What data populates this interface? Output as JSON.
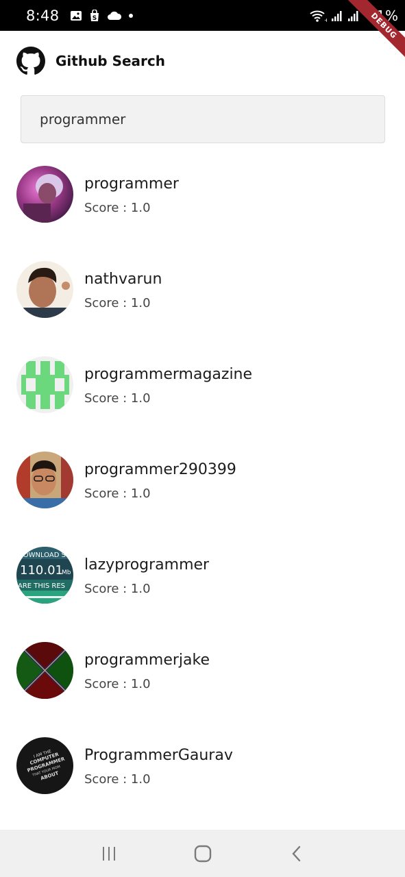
{
  "status_bar": {
    "time": "8:48",
    "battery": "31%",
    "icons": [
      "gallery-icon",
      "shop-icon",
      "cloud-icon",
      "dot-icon",
      "wifi-icon",
      "signal-icon",
      "signal-icon"
    ]
  },
  "debug_banner": "DEBUG",
  "app_bar": {
    "title": "Github Search",
    "logo_icon": "github-logo-icon"
  },
  "search": {
    "value": "programmer",
    "placeholder": ""
  },
  "users": [
    {
      "name": "programmer",
      "score": "Score : 1.0"
    },
    {
      "name": "nathvarun",
      "score": "Score : 1.0"
    },
    {
      "name": "programmermagazine",
      "score": "Score : 1.0"
    },
    {
      "name": "programmer290399",
      "score": "Score : 1.0"
    },
    {
      "name": "lazyprogrammer",
      "score": "Score : 1.0"
    },
    {
      "name": "programmerjake",
      "score": "Score : 1.0"
    },
    {
      "name": "ProgrammerGaurav",
      "score": "Score : 1.0"
    }
  ],
  "avatar_texts": {
    "lazyprogrammer": [
      "DOWNLOAD S",
      "110.01",
      "Mb",
      "ARE THIS RES"
    ],
    "programmergaurav": [
      "I AM THE",
      "COMPUTER",
      "PROGRAMMER",
      "THAT YOUR MOM",
      "ABOUT"
    ]
  },
  "nav_bar": {
    "icons": [
      "recent-apps-icon",
      "home-icon",
      "back-icon"
    ]
  },
  "colors": {
    "status_bar": "#000000",
    "debug_ribbon": "#a3272f",
    "search_bg": "#f2f2f2",
    "nav_bg": "#f0f0f0"
  }
}
